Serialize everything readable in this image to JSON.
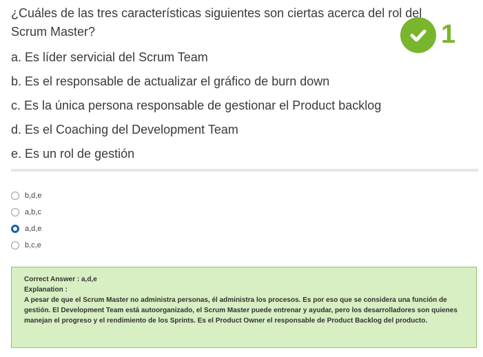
{
  "question": {
    "text": "¿Cuáles de las tres características siguientes son ciertas acerca del rol del Scrum Master?",
    "options": [
      "a. Es líder servicial del Scrum Team",
      "b. Es el responsable de actualizar el gráfico de burn down",
      "c. Es la única persona responsable de gestionar el Product backlog",
      "d. Es el Coaching del Development Team",
      "e. Es un rol de gestión"
    ]
  },
  "badge": {
    "icon": "check-icon",
    "count": "1",
    "color": "#78b62e"
  },
  "choices": [
    {
      "label": "b,d,e",
      "selected": false
    },
    {
      "label": "a,b,c",
      "selected": false
    },
    {
      "label": "a,d,e",
      "selected": true
    },
    {
      "label": "b,c,e",
      "selected": false
    }
  ],
  "answer": {
    "correct": "Correct Answer : a,d,e",
    "explanation_label": "Explanation :",
    "explanation": "A pesar de que el Scrum Master no administra personas, él administra los procesos. Es por eso que se considera una función de gestión. El Development Team está autoorganizado, el Scrum Master puede entrenar y ayudar, pero los desarrolladores son quienes manejan el progreso y el rendimiento de los Sprints. Es el Product Owner el responsable de  Product Backlog del producto."
  }
}
